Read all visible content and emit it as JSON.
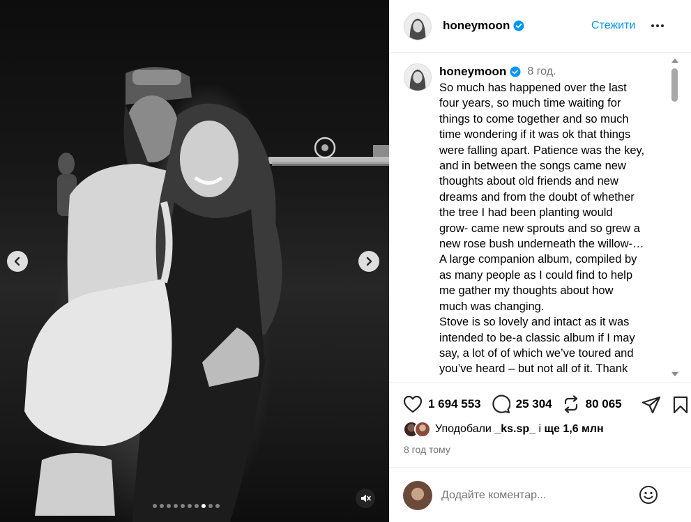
{
  "post": {
    "username": "honeymoon",
    "follow_label": "Стежити",
    "more_label": "...",
    "caption_time": "8 год.",
    "caption_lines": [
      "So much has happened over the last",
      "four years, so much time waiting for",
      "things to come together and so much",
      "time wondering if it was ok that things",
      "were falling apart. Patience was the key,",
      "and in between the songs came new",
      "thoughts about old friends and new",
      "dreams and from the doubt of whether",
      "the tree I had been planting would",
      "grow- came new sprouts and so grew a",
      "new rose bush underneath the willow-…",
      "A large companion album, compiled by",
      "as many people as I could find to help",
      "me gather my thoughts about how",
      "much was changing.",
      "Stove is so lovely and intact as it was",
      "intended to be-a classic album if I may",
      "say, a lot of of which we’ve toured and",
      "you’ve heard – but not all of it. Thank"
    ]
  },
  "stats": {
    "likes": "1 694 553",
    "comments": "25 304",
    "reposts": "80 065"
  },
  "likes_line": {
    "prefix": "Уподобали",
    "user": "_ks.sp_",
    "middle": "і",
    "rest": "ще 1,6 млн"
  },
  "timestamp": "8 год тому",
  "comment": {
    "placeholder": "Додайте коментар..."
  },
  "carousel": {
    "total": 10,
    "active_index": 7
  },
  "icons": {
    "verified": "verified-badge-icon",
    "heart": "heart-icon",
    "comment": "comment-bubble-icon",
    "repost": "repost-icon",
    "share": "paper-plane-icon",
    "save": "bookmark-icon",
    "emoji": "emoji-icon",
    "mute": "muted-speaker-icon",
    "prev": "chevron-left-icon",
    "next": "chevron-right-icon"
  },
  "colors": {
    "accent": "#0095f6",
    "verified": "#0095f6",
    "muted_text": "#737373"
  }
}
